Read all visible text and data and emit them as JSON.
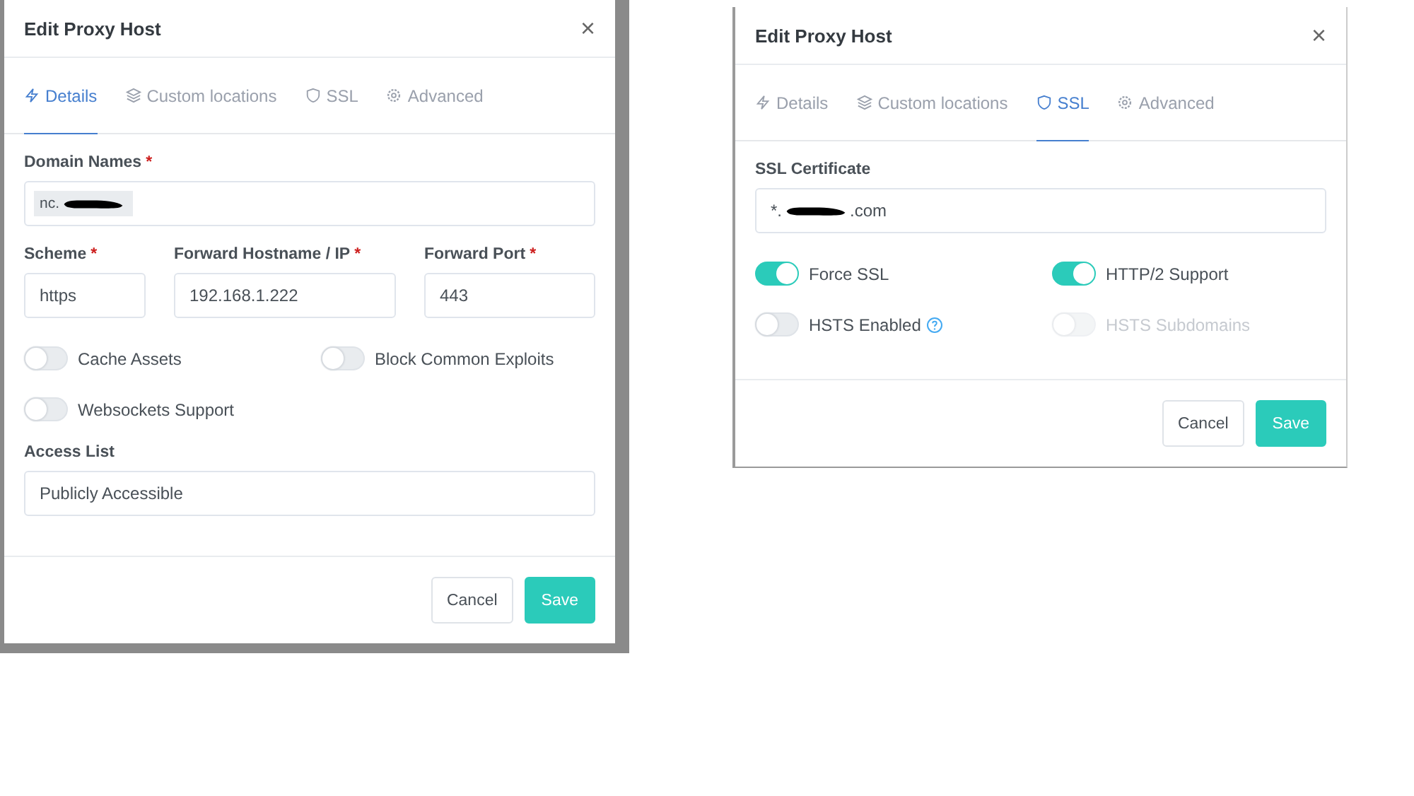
{
  "dialogs": [
    {
      "title": "Edit Proxy Host",
      "close": "×",
      "tabs": [
        {
          "label": "Details",
          "selected": true
        },
        {
          "label": "Custom locations",
          "selected": false
        },
        {
          "label": "SSL",
          "selected": false
        },
        {
          "label": "Advanced",
          "selected": false
        }
      ],
      "body": [
        {
          "kind": "field",
          "label": "Domain Names",
          "required_mark": "*",
          "tag_parts": [
            {
              "kind": "text",
              "text": "nc."
            },
            {
              "kind": "redacted"
            }
          ]
        },
        {
          "kind": "field-row",
          "fields": [
            {
              "label": "Scheme",
              "required_mark": "*",
              "value": "https"
            },
            {
              "label": "Forward Hostname / IP",
              "required_mark": "*",
              "value": "192.168.1.222"
            },
            {
              "label": "Forward Port",
              "required_mark": "*",
              "value": "443"
            }
          ]
        },
        {
          "kind": "toggles",
          "toggles": [
            {
              "label": "Cache Assets",
              "on": false,
              "disabled": false
            },
            {
              "label": "Block Common Exploits",
              "on": false,
              "disabled": false
            },
            {
              "label": "Websockets Support",
              "on": false,
              "disabled": false
            }
          ]
        },
        {
          "kind": "field",
          "label": "Access List",
          "parts": [
            {
              "kind": "text",
              "text": "Publicly Accessible"
            }
          ]
        }
      ],
      "buttons": [
        {
          "label": "Cancel",
          "kind": "secondary"
        },
        {
          "label": "Save",
          "kind": "primary"
        }
      ]
    },
    {
      "title": "Edit Proxy Host",
      "close": "×",
      "tabs": [
        {
          "label": "Details",
          "selected": false
        },
        {
          "label": "Custom locations",
          "selected": false
        },
        {
          "label": "SSL",
          "selected": true
        },
        {
          "label": "Advanced",
          "selected": false
        }
      ],
      "body": [
        {
          "kind": "field",
          "label": "SSL Certificate",
          "parts": [
            {
              "kind": "text",
              "text": "*."
            },
            {
              "kind": "redacted"
            },
            {
              "kind": "text",
              "text": ".com"
            }
          ]
        },
        {
          "kind": "toggles",
          "toggles": [
            {
              "label": "Force SSL",
              "on": true,
              "disabled": false,
              "help": false
            },
            {
              "label": "HTTP/2 Support",
              "on": true,
              "disabled": false,
              "help": false
            },
            {
              "label": "HSTS Enabled",
              "on": false,
              "disabled": false,
              "help": true
            },
            {
              "label": "HSTS Subdomains",
              "on": false,
              "disabled": true,
              "help": false
            }
          ]
        }
      ],
      "buttons": [
        {
          "label": "Cancel",
          "kind": "secondary"
        },
        {
          "label": "Save",
          "kind": "primary"
        }
      ]
    }
  ]
}
